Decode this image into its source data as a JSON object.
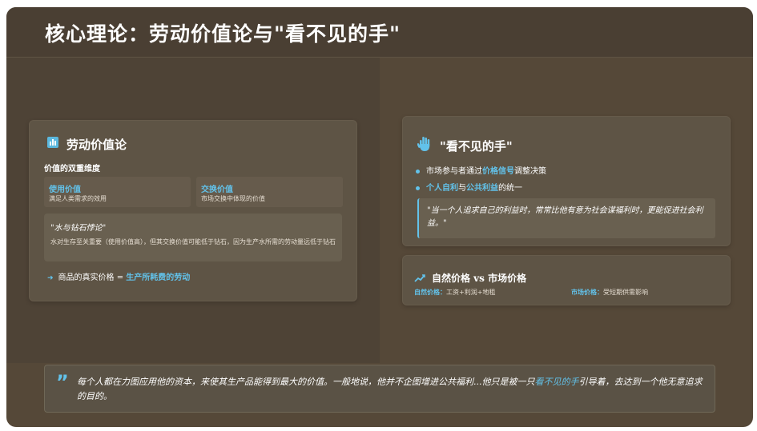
{
  "title": "核心理论：劳动价值论与\"看不见的手\"",
  "labor": {
    "title": "劳动价值论",
    "icon": "bar-chart-icon",
    "subheading": "价值的双重维度",
    "use_value": {
      "label": "使用价值",
      "desc": "满足人类需求的效用"
    },
    "exchange_value": {
      "label": "交换价值",
      "desc": "市场交换中体现的价值"
    },
    "paradox_title": "\"水与钻石悖论\"",
    "paradox_text": "水对生存至关重要（使用价值高），但其交换价值可能低于钻石，因为生产水所需的劳动量远低于钻石",
    "price_prefix": "商品的真实价格 = ",
    "price_highlight": "生产所耗费的劳动"
  },
  "hand": {
    "title": "\"看不见的手\"",
    "icon": "hand-icon",
    "bullet1_pre": "市场参与者通过",
    "bullet1_hl": "价格信号",
    "bullet1_post": "调整决策",
    "bullet2_hl1": "个人自利",
    "bullet2_mid": "与",
    "bullet2_hl2": "公共利益",
    "bullet2_post": "的统一",
    "quote": "\"当一个人追求自己的利益时，常常比他有意为社会谋福利时，更能促进社会利益。\""
  },
  "price": {
    "title": "自然价格 vs 市场价格",
    "icon": "trend-line-icon",
    "natural_label": "自然价格：",
    "natural_desc": "工资+利润+地租",
    "market_label": "市场价格：",
    "market_desc": "受短期供需影响"
  },
  "bottom_quote": {
    "icon": "quote-icon",
    "pre": "每个人都在力图应用他的资本，来使其生产品能得到最大的价值。一般地说，他并不企图增进公共福利...他只是被一只",
    "highlight": "看不见的手",
    "post": "引导着，去达到一个他无意追求的目的。"
  },
  "colors": {
    "background": "#554838",
    "accent": "#62c2ea",
    "card": "#5e5445"
  }
}
